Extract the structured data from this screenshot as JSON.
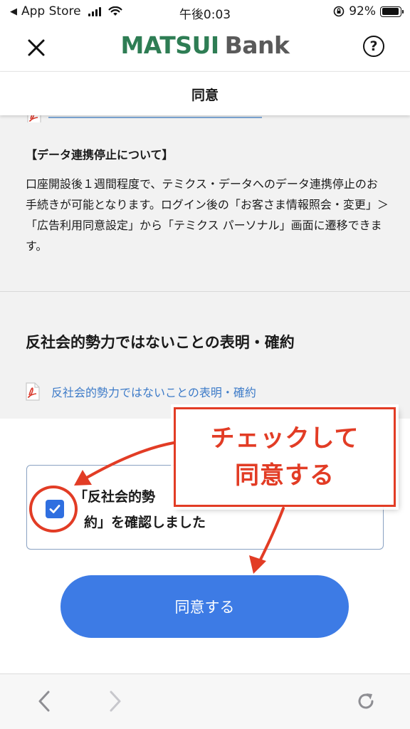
{
  "status_bar": {
    "carrier": "App Store",
    "time": "午後0:03",
    "battery": "92%",
    "battery_level": 0.92
  },
  "header": {
    "brand_primary": "MATSUI",
    "brand_secondary": "Bank",
    "help_symbol": "?",
    "colors": {
      "brand_green": "#2e7d54",
      "brand_gray": "#5a5a5a"
    }
  },
  "nav": {
    "title": "同意"
  },
  "data_section": {
    "heading": "【データ連携停止について】",
    "body": "口座開設後１週間程度で、テミクス・データへのデータ連携停止のお手続きが可能となります。ログイン後の「お客さま情報照会・変更」＞「広告利用同意設定」から「テミクス パーソナル」画面に遷移できます。"
  },
  "declaration_section": {
    "title": "反社会的勢力ではないことの表明・確約",
    "pdf_link": "反社会的勢力ではないことの表明・確約",
    "icons": [
      "pdf-icon"
    ]
  },
  "agreement": {
    "checked": true,
    "line1": "「反社会的勢",
    "line2": "約」を確認しました"
  },
  "annotation": {
    "line1": "チェックして",
    "line2": "同意する",
    "color": "#e23c25"
  },
  "agree_button": {
    "label": "同意する",
    "color": "#3d7be5"
  },
  "toolbar": {
    "icons": [
      "back-icon",
      "forward-icon",
      "reload-icon"
    ]
  }
}
